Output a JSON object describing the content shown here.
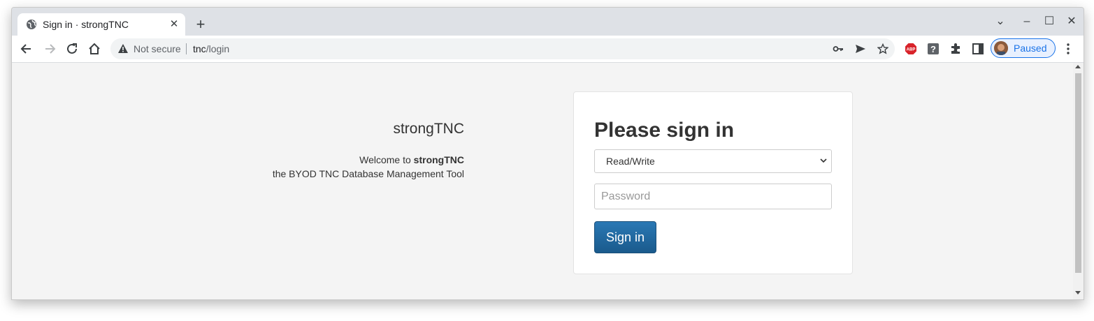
{
  "browser": {
    "tab_title": "Sign in · strongTNC",
    "tab_close": "✕",
    "new_tab": "+",
    "window_controls": {
      "dropdown": "⌄",
      "minimize": "–",
      "maximize": "☐",
      "close": "✕"
    },
    "security_label": "Not secure",
    "url_host": "tnc",
    "url_path": "/login",
    "profile_label": "Paused",
    "extensions": [
      "abp-icon",
      "help-icon",
      "puzzle-icon",
      "sidepanel-icon"
    ],
    "accent_color": "#1a73e8"
  },
  "page": {
    "brand": "strongTNC",
    "welcome_prefix": "Welcome to ",
    "welcome_brand": "strongTNC",
    "tagline": "the BYOD TNC Database Management Tool"
  },
  "signin": {
    "heading": "Please sign in",
    "access_mode": "Read/Write",
    "password_placeholder": "Password",
    "button_label": "Sign in",
    "button_color": "#1f6aa5"
  }
}
